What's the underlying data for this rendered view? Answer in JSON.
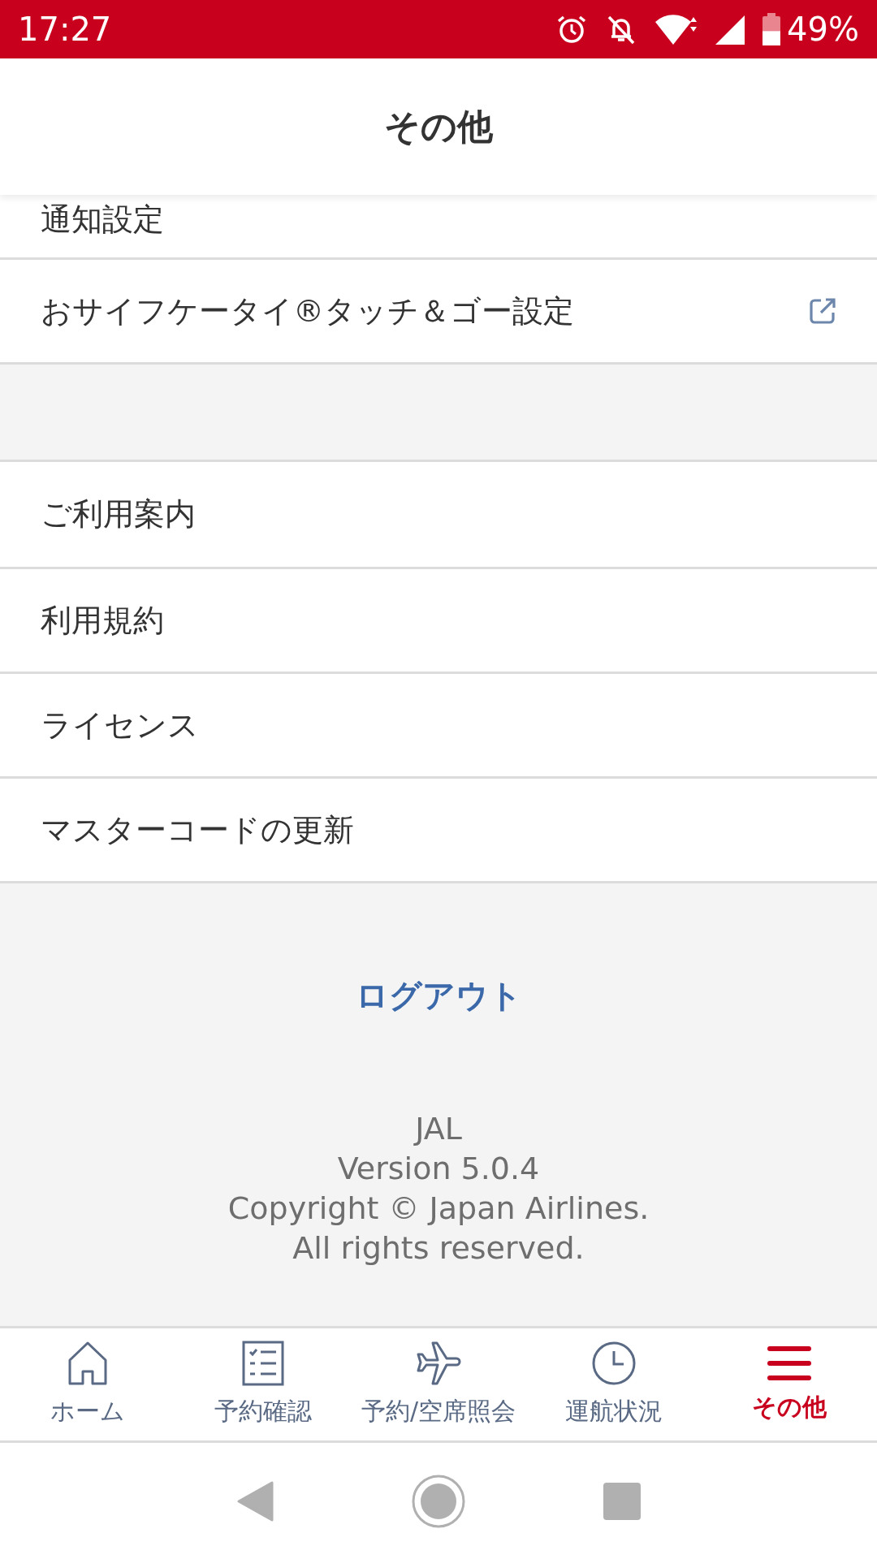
{
  "status_bar": {
    "time": "17:27",
    "battery": "49%"
  },
  "header": {
    "title": "その他"
  },
  "menu_groups": [
    [
      {
        "label": "通知設定",
        "external_link": false
      },
      {
        "label": "おサイフケータイ®タッチ＆ゴー設定",
        "external_link": true
      }
    ],
    [
      {
        "label": "ご利用案内",
        "external_link": false
      },
      {
        "label": "利用規約",
        "external_link": false
      },
      {
        "label": "ライセンス",
        "external_link": false
      },
      {
        "label": "マスターコードの更新",
        "external_link": false
      }
    ]
  ],
  "logout": "ログアウト",
  "footer": [
    "JAL",
    "Version 5.0.4",
    "Copyright © Japan Airlines.",
    "All rights reserved."
  ],
  "tabs": [
    {
      "label": "ホーム",
      "selected": false
    },
    {
      "label": "予約確認",
      "selected": false
    },
    {
      "label": "予約/空席照会",
      "selected": false
    },
    {
      "label": "運航状況",
      "selected": false
    },
    {
      "label": "その他",
      "selected": true
    }
  ]
}
